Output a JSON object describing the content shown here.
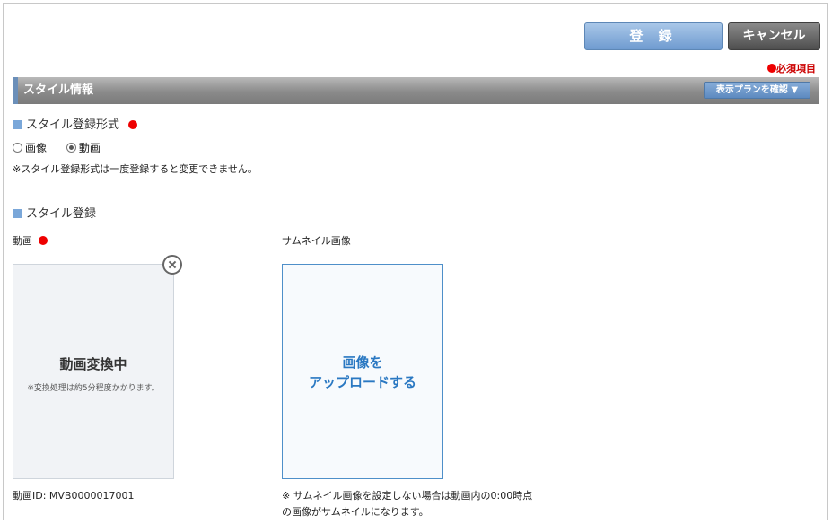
{
  "toolbar": {
    "register_label": "登 録",
    "cancel_label": "キャンセル"
  },
  "required_legend": "必須項目",
  "section": {
    "title": "スタイル情報",
    "plan_button": "表示プランを確認 ▼"
  },
  "format": {
    "heading": "スタイル登録形式",
    "options": [
      {
        "label": "画像",
        "checked": false
      },
      {
        "label": "動画",
        "checked": true
      }
    ],
    "note": "※スタイル登録形式は一度登録すると変更できません。"
  },
  "registration": {
    "heading": "スタイル登録",
    "video_label": "動画",
    "thumbnail_label": "サムネイル画像",
    "video_status": "動画変換中",
    "video_status_note": "※変換処理は約5分程度かかります。",
    "upload_line1": "画像を",
    "upload_line2": "アップロードする",
    "video_id": "動画ID: MVB0000017001",
    "thumbnail_note_line1": "※ サムネイル画像を設定しない場合は動画内の0:00時点",
    "thumbnail_note_line2": "の画像がサムネイルになります。"
  },
  "colors": {
    "accent": "#6f9bd0",
    "required": "#e00000",
    "upload_text": "#2a78c2"
  }
}
